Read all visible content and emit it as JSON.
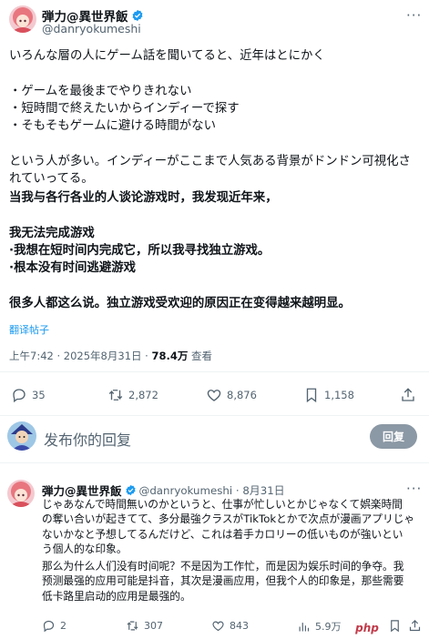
{
  "author": {
    "name": "弾力@異世界飯",
    "handle": "@danryokumeshi"
  },
  "tweet": {
    "original_lines": [
      "いろんな層の人にゲーム話を聞いてると、近年はとにかく",
      "",
      "・ゲームを最後までやりきれない",
      "・短時間で終えたいからインディーで探す",
      "・そもそもゲームに避ける時間がない",
      "",
      "という人が多い。インディーがここまで人気ある背景がドンドン可視化さ",
      "れていってる。"
    ],
    "translated_lines": [
      "当我与各行各业的人谈论游戏时，我发现近年来，",
      "",
      "我无法完成游戏",
      "·我想在短时间内完成它，所以我寻找独立游戏。",
      "·根本没有时间逃避游戏",
      "",
      "很多人都这么说。独立游戏受欢迎的原因正在变得越来越明显。"
    ],
    "translate_link": "翻译帖子",
    "time": "上午7:42 · 2025年8月31日 · ",
    "views": "78.4万",
    "views_suffix": " 查看"
  },
  "actions": {
    "replies": "35",
    "retweets": "2,872",
    "likes": "8,876",
    "bookmarks": "1,158"
  },
  "compose": {
    "placeholder": "发布你的回复",
    "button": "回复"
  },
  "reply": {
    "name": "弾力@異世界飯",
    "handle_date": "@danryokumeshi · 8月31日",
    "original_lines": [
      "じゃあなんで時間無いのかというと、仕事が忙しいとかじゃなくて娯楽時間",
      "の奪い合いが起きてて、多分最強クラスがTikTokとかで次点が漫画アプリじゃ",
      "ないかなと予想してるんだけど、これは着手カロリーの低いものが強いとい",
      "う個人的な印象。"
    ],
    "translated_lines": [
      "那么为什么人们没有时间呢？不是因为工作忙，而是因为娱乐时间的争夺。我",
      "预测最强的应用可能是抖音，其次是漫画应用，但我个人的印象是，那些需要",
      "低卡路里启动的应用是最强的。"
    ],
    "actions": {
      "replies": "2",
      "retweets": "307",
      "likes": "843",
      "views": "5.9万"
    }
  },
  "watermark": "php",
  "colors": {
    "verified": "#1d9bf0",
    "link": "#1d9bf0",
    "secondary": "#536471",
    "button": "#8b98a5"
  }
}
